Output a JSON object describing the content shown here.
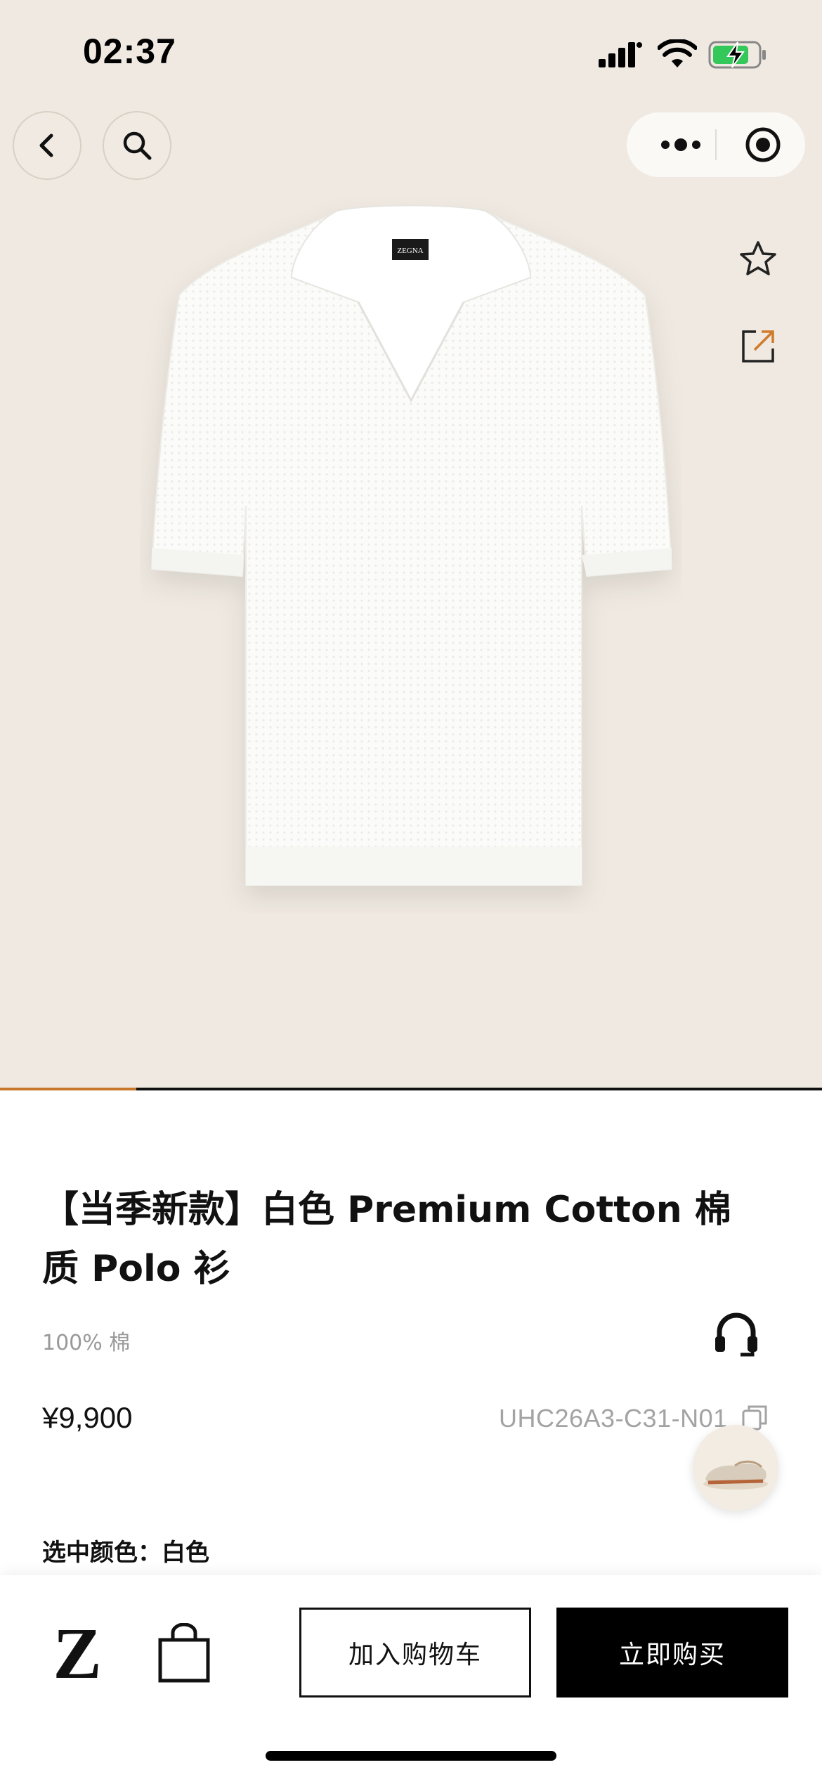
{
  "status_bar": {
    "time": "02:37"
  },
  "nav": {
    "back_icon": "chevron-left-icon",
    "search_icon": "search-icon",
    "more_icon": "more-dots-icon",
    "close_icon": "target-circle-icon"
  },
  "gallery": {
    "progress": 0.166,
    "label_on_collar": "ZEGNA"
  },
  "product": {
    "title": "【当季新款】白色 Premium Cotton 棉质 Polo 衫",
    "material": "100% 棉",
    "price": "¥9,900",
    "sku": "UHC26A3-C31-N01",
    "selected_color_label": "选中颜色：白色"
  },
  "actions": {
    "add_to_cart": "加入购物车",
    "buy_now": "立即购买",
    "logo_letter": "Z"
  },
  "colors": {
    "hero_bg": "#efe9e1",
    "progress_accent": "#c8782a",
    "primary": "#000000"
  }
}
